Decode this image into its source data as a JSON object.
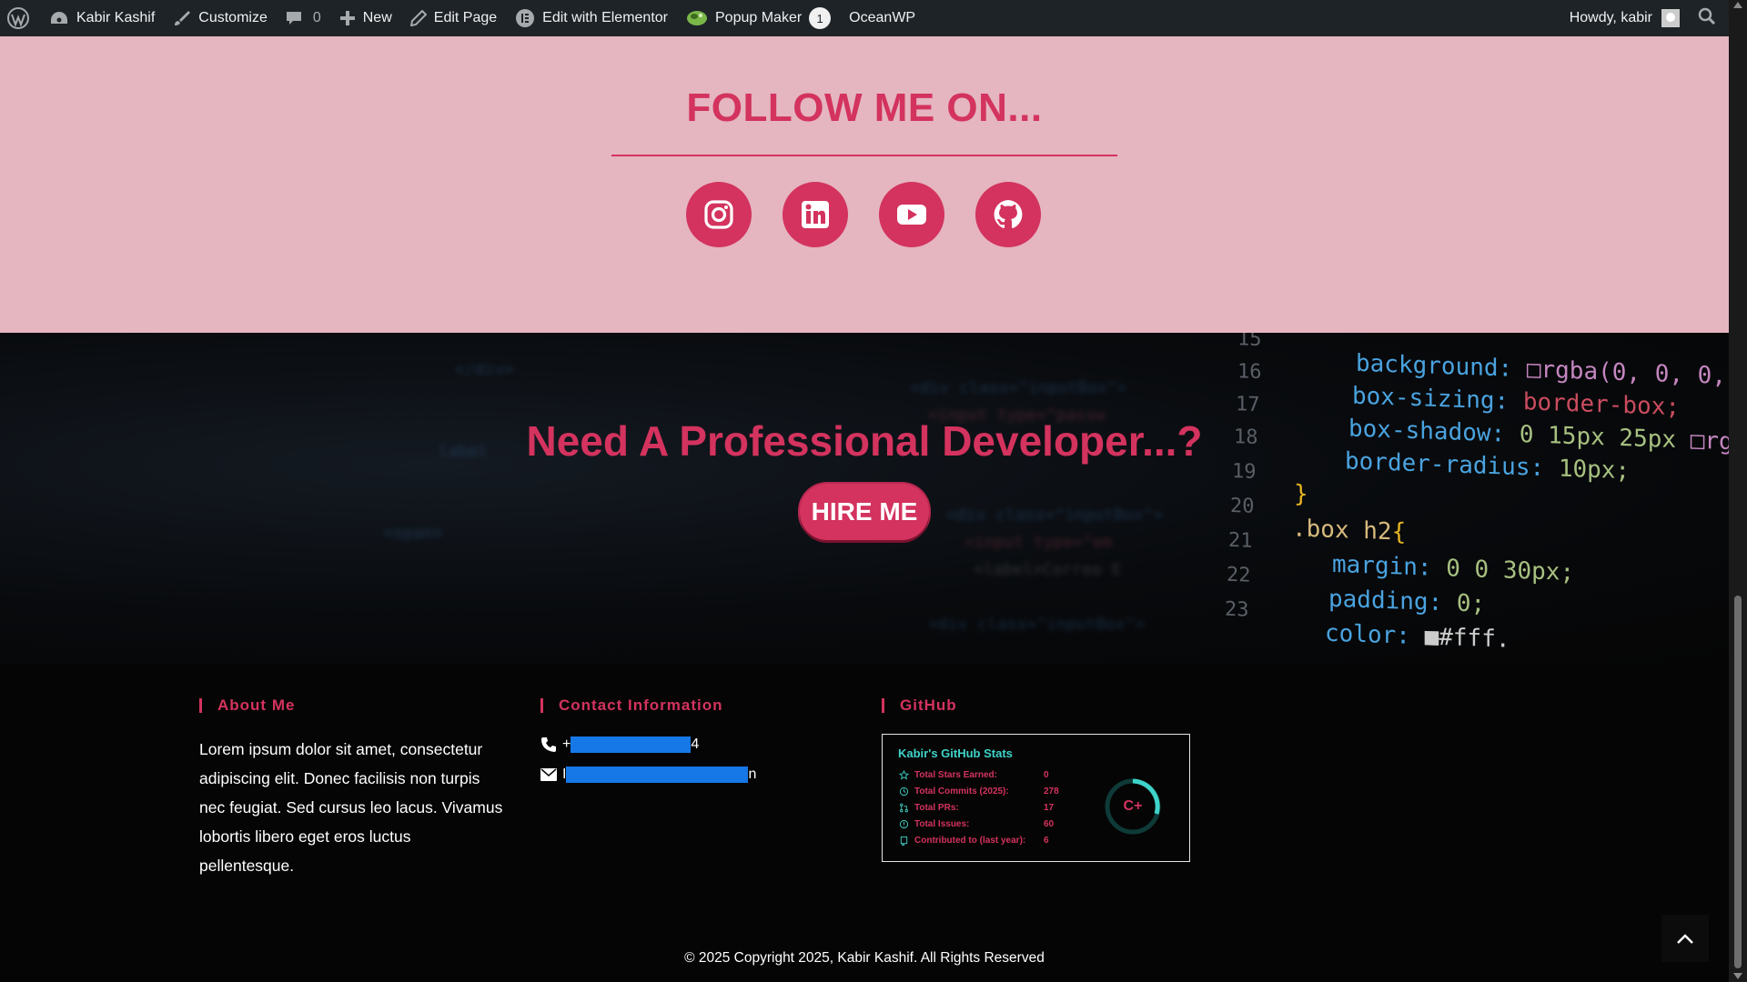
{
  "adminbar": {
    "site_name": "Kabir Kashif",
    "customize": "Customize",
    "comments_count": "0",
    "new": "New",
    "edit_page": "Edit Page",
    "edit_elementor": "Edit with Elementor",
    "popup_maker": "Popup Maker",
    "popup_badge": "1",
    "oceanwp": "OceanWP",
    "howdy": "Howdy, kabir"
  },
  "follow": {
    "title": "FOLLOW ME ON...",
    "socials": [
      "instagram",
      "linkedin",
      "youtube",
      "github"
    ]
  },
  "hero": {
    "title": "Need A Professional Developer...?",
    "button": "HIRE ME"
  },
  "footer": {
    "about": {
      "title": "About Me",
      "text": "Lorem ipsum dolor sit amet, consectetur adipiscing elit. Donec facilisis non turpis nec feugiat. Sed cursus leo lacus. Vivamus lobortis libero eget eros luctus pellentesque."
    },
    "contact": {
      "title": "Contact Information",
      "phone_prefix": "+",
      "phone_suffix": "4",
      "email_prefix": "I",
      "email_suffix": "n"
    },
    "github": {
      "title": "GitHub",
      "card_title": "Kabir's GitHub Stats",
      "stats": [
        {
          "label": "Total Stars Earned:",
          "value": "0"
        },
        {
          "label": "Total Commits (2025):",
          "value": "278"
        },
        {
          "label": "Total PRs:",
          "value": "17"
        },
        {
          "label": "Total Issues:",
          "value": "60"
        },
        {
          "label": "Contributed to (last year):",
          "value": "6"
        }
      ],
      "grade": "C+"
    },
    "copyright": "© 2025 Copyright 2025, Kabir Kashif. All Rights Reserved"
  },
  "colors": {
    "accent": "#d3335e",
    "follow_bg": "#e5b5c0",
    "admin_bar": "#1d2327",
    "github_teal": "#3fd3c9"
  }
}
